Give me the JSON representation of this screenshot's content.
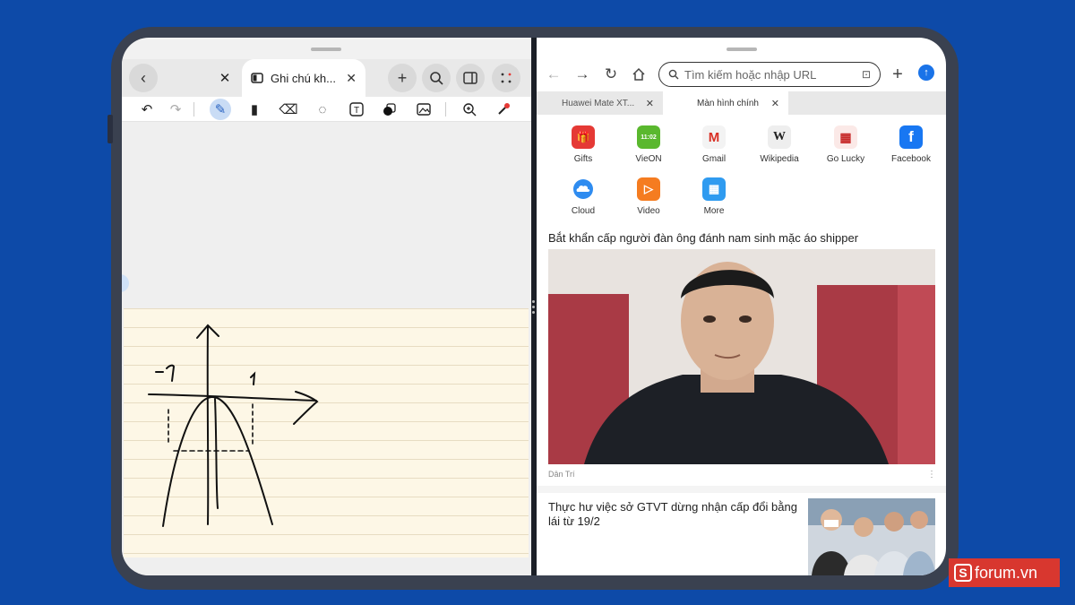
{
  "notes": {
    "tab_title": "Ghi chú kh...",
    "toolbar": [
      "undo-icon",
      "redo-icon",
      "pen-icon",
      "marker-icon",
      "eraser-icon",
      "lasso-icon",
      "text-box-icon",
      "shape-icon",
      "image-icon",
      "zoom-icon",
      "color-picker-icon"
    ]
  },
  "browser": {
    "search_placeholder": "Tìm kiếm hoặc nhập URL",
    "tabs": [
      "Huawei Mate XT...",
      "Màn hình chính"
    ],
    "shortcuts": [
      {
        "label": "Gifts",
        "color": "#e53935"
      },
      {
        "label": "VieON",
        "color": "#5ab82e"
      },
      {
        "label": "Gmail",
        "color": "#ffffff"
      },
      {
        "label": "Wikipedia",
        "color": "#f1f1f1"
      },
      {
        "label": "Go Lucky",
        "color": "#ffffff"
      },
      {
        "label": "Facebook",
        "color": "#1877f2"
      },
      {
        "label": "Cloud",
        "color": "#ffffff"
      },
      {
        "label": "Video",
        "color": "#f57c20"
      },
      {
        "label": "More",
        "color": "#2f9bf0"
      }
    ],
    "article1": {
      "headline": "Bắt khẩn cấp người đàn ông đánh nam sinh mặc áo shipper",
      "source": "Dân Trí"
    },
    "article2": {
      "headline": "Thực hư việc sở GTVT dừng nhận cấp đổi bằng lái từ 19/2"
    }
  },
  "watermark": "forum.vn",
  "colors": {
    "background": "#0d4aa8",
    "accent": "#1a73e8",
    "logo": "#d8372f"
  }
}
